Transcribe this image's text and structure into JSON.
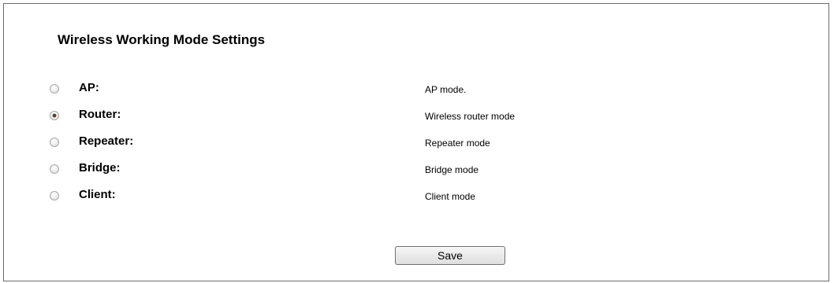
{
  "section": {
    "title": "Wireless Working Mode Settings"
  },
  "modes": [
    {
      "label": "AP:",
      "description": "AP mode.",
      "selected": false
    },
    {
      "label": "Router:",
      "description": "Wireless router mode",
      "selected": true
    },
    {
      "label": "Repeater:",
      "description": "Repeater mode",
      "selected": false
    },
    {
      "label": "Bridge:",
      "description": "Bridge mode",
      "selected": false
    },
    {
      "label": "Client:",
      "description": "Client mode",
      "selected": false
    }
  ],
  "actions": {
    "save_label": "Save"
  },
  "colors": {
    "border": "#6b6b6b",
    "radio_dot": "#5a3a2a"
  }
}
